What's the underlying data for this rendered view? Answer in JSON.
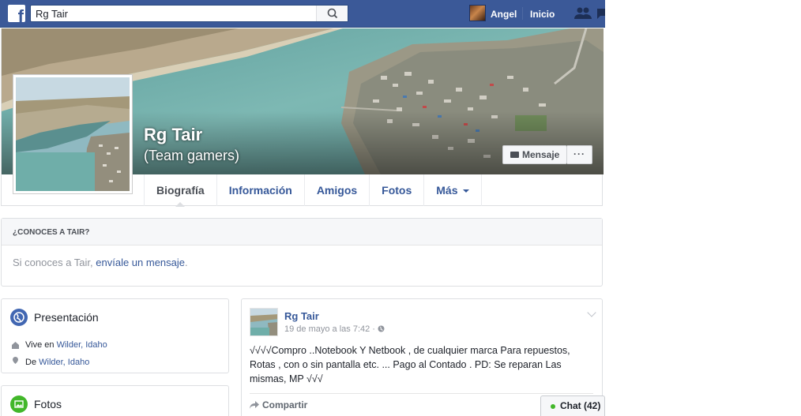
{
  "topbar": {
    "logo_letter": "f",
    "search_value": "Rg Tair",
    "user_name": "Angel",
    "home_label": "Inicio"
  },
  "profile": {
    "name": "Rg Tair",
    "alternate_name": "(Team gamers)",
    "message_button": "Mensaje",
    "more_button": "···"
  },
  "tabs": [
    {
      "label": "Biografía"
    },
    {
      "label": "Información"
    },
    {
      "label": "Amigos"
    },
    {
      "label": "Fotos"
    },
    {
      "label": "Más"
    }
  ],
  "know_box": {
    "header": "¿CONOCES A TAIR?",
    "text_before": "Si conoces a Tair, ",
    "link": "envíale un mensaje",
    "text_after": "."
  },
  "intro": {
    "title": "Presentación",
    "lives_prefix": "Vive en ",
    "lives_place": "Wilder, Idaho",
    "from_prefix": "De ",
    "from_place": "Wilder, Idaho"
  },
  "photos": {
    "title": "Fotos"
  },
  "post": {
    "author": "Rg Tair",
    "time": "19 de mayo a las 7:42 · ",
    "text": "√√√√Compro ..Notebook Y Netbook , de cualquier marca Para repuestos, Rotas , con o sin pantalla etc. ... Pago al Contado . PD: Se reparan Las mismas, MP √√√",
    "share_label": "Compartir"
  },
  "chat": {
    "label": "Chat (42)"
  },
  "colors": {
    "facebook_blue": "#3b5998",
    "link_blue": "#365899",
    "online_green": "#42b72a"
  },
  "icons": [
    "facebook-logo-icon",
    "search-icon",
    "friend-requests-icon",
    "message-icon",
    "globe-icon",
    "house-icon",
    "location-pin-icon",
    "photo-icon",
    "share-arrow-icon",
    "privacy-globe-icon",
    "chevron-down-icon"
  ]
}
